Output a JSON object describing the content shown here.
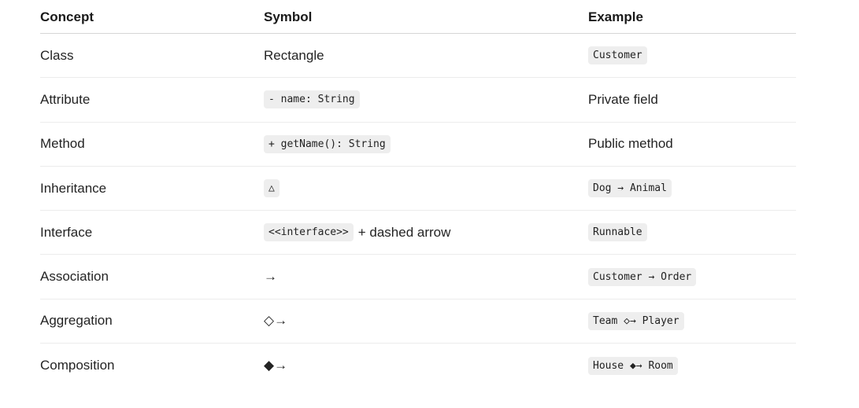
{
  "headers": {
    "concept": "Concept",
    "symbol": "Symbol",
    "example": "Example"
  },
  "rows": [
    {
      "concept": "Class",
      "symbol_text": "Rectangle",
      "example_code": "Customer"
    },
    {
      "concept": "Attribute",
      "symbol_code": "- name: String",
      "example_text": "Private field"
    },
    {
      "concept": "Method",
      "symbol_code": "+ getName(): String",
      "example_text": "Public method"
    },
    {
      "concept": "Inheritance",
      "symbol_code": "△",
      "example_code": "Dog → Animal"
    },
    {
      "concept": "Interface",
      "symbol_code": "<<interface>>",
      "symbol_suffix": "+ dashed arrow",
      "example_code": "Runnable"
    },
    {
      "concept": "Association",
      "symbol_text": "→",
      "example_code": "Customer → Order"
    },
    {
      "concept": "Aggregation",
      "symbol_text": "◇→",
      "example_code": "Team ◇→ Player"
    },
    {
      "concept": "Composition",
      "symbol_text": "◆→",
      "example_code": "House ◆→ Room"
    }
  ]
}
